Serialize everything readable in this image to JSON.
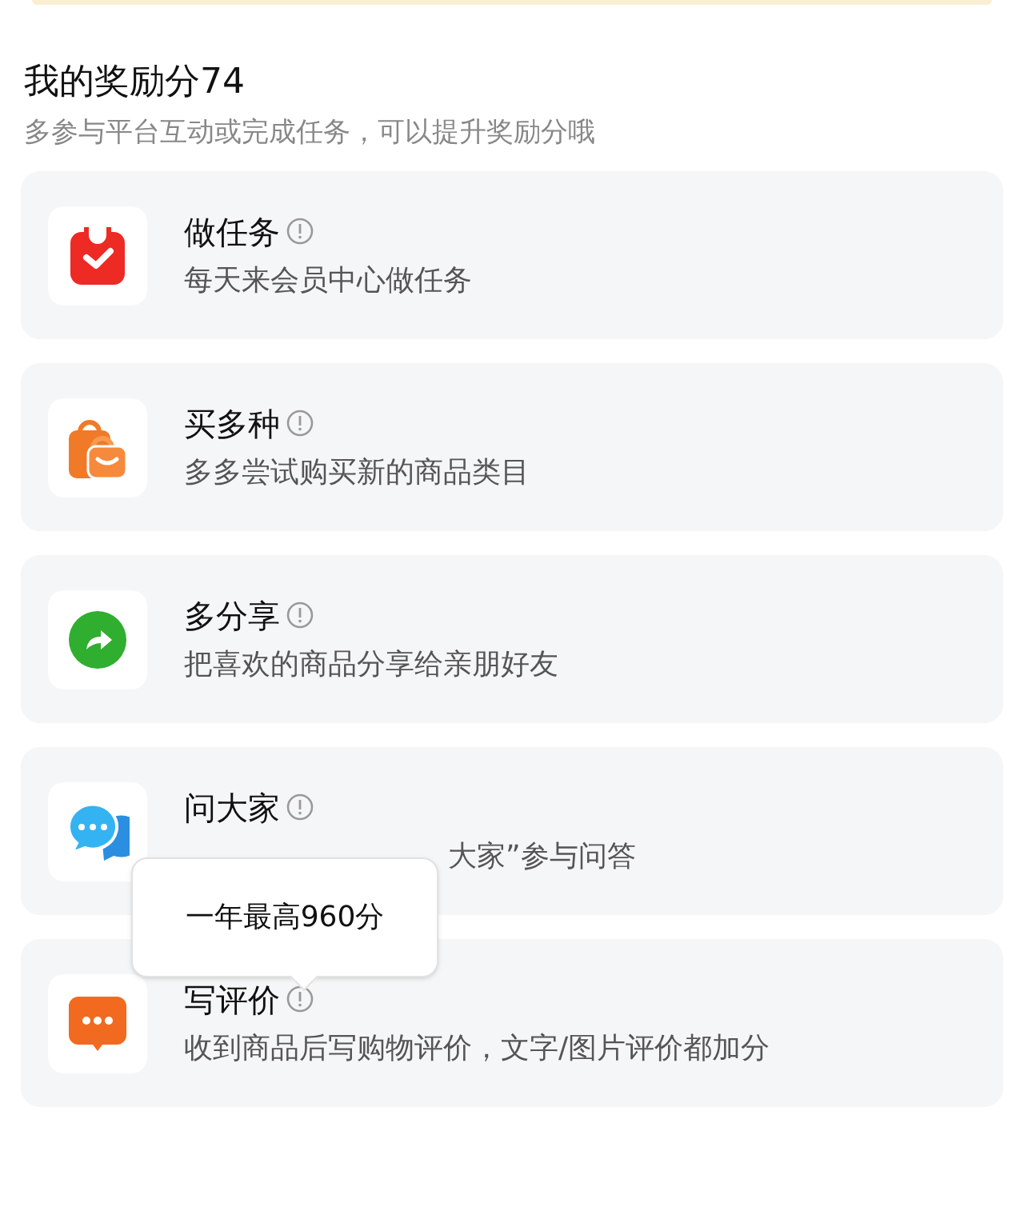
{
  "heading": "我的奖励分74",
  "subheading": "多参与平台互动或完成任务，可以提升奖励分哦",
  "tasks": [
    {
      "kind": "task",
      "title": "做任务",
      "subtitle": "每天来会员中心做任务"
    },
    {
      "kind": "shop",
      "title": "买多种",
      "subtitle": "多多尝试购买新的商品类目"
    },
    {
      "kind": "share",
      "title": "多分享",
      "subtitle": "把喜欢的商品分享给亲朋好友"
    },
    {
      "kind": "ask",
      "title": "问大家",
      "subtitle": "大家”参与问答",
      "covered": true
    },
    {
      "kind": "review",
      "title": "写评价",
      "subtitle": "收到商品后写购物评价，文字/图片评价都加分"
    }
  ],
  "tooltip": {
    "text": "一年最高960分"
  }
}
